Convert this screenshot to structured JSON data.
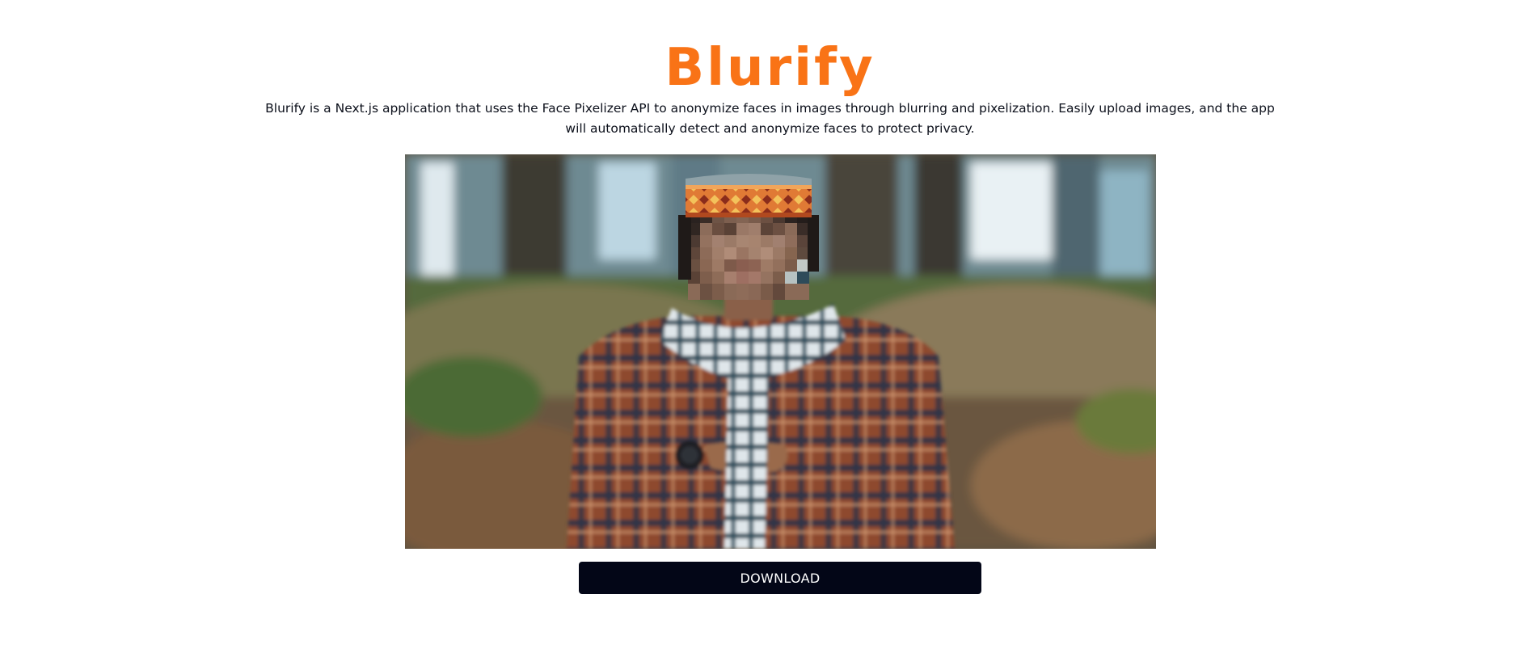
{
  "app": {
    "title": "Blurify",
    "description": "Blurify is a Next.js application that uses the Face Pixelizer API to anonymize faces in images through blurring and pixelization. Easily upload images, and the app will automatically detect and anonymize faces to protect privacy."
  },
  "result": {
    "image_alt": "Anonymized photo of a person with a pixelated face",
    "download_label": "DOWNLOAD"
  },
  "colors": {
    "brand": "#f97316",
    "button": "#030617",
    "button_text": "#ffffff",
    "text": "#0b0f1a"
  }
}
